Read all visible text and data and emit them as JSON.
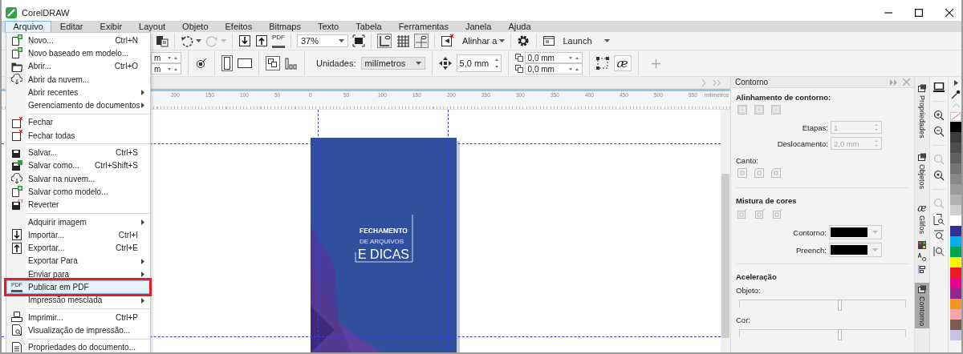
{
  "window": {
    "title": "CorelDRAW"
  },
  "menubar": [
    {
      "label": "Arquivo",
      "selected": true
    },
    {
      "label": "Editar",
      "selected": false
    },
    {
      "label": "Exibir",
      "selected": false
    },
    {
      "label": "Layout",
      "selected": false
    },
    {
      "label": "Objeto",
      "selected": false
    },
    {
      "label": "Efeitos",
      "selected": false
    },
    {
      "label": "Bitmaps",
      "selected": false
    },
    {
      "label": "Texto",
      "selected": false
    },
    {
      "label": "Tabela",
      "selected": false
    },
    {
      "label": "Ferramentas",
      "selected": false
    },
    {
      "label": "Janela",
      "selected": false
    },
    {
      "label": "Ajuda",
      "selected": false
    }
  ],
  "file_menu": {
    "items": [
      {
        "kind": "item",
        "label": "Novo...",
        "shortcut": "Ctrl+N",
        "submenu": false,
        "selected": false,
        "outlined": false
      },
      {
        "kind": "item",
        "label": "Novo baseado em modelo...",
        "submenu": false,
        "selected": false,
        "outlined": false
      },
      {
        "kind": "item",
        "label": "Abrir...",
        "shortcut": "Ctrl+O",
        "submenu": false,
        "selected": false,
        "outlined": false
      },
      {
        "kind": "item",
        "label": "Abrir da nuvem...",
        "submenu": false,
        "selected": false,
        "outlined": false
      },
      {
        "kind": "item",
        "label": "Abrir recentes",
        "submenu": true,
        "selected": false,
        "outlined": false
      },
      {
        "kind": "item",
        "label": "Gerenciamento de documentos",
        "submenu": true,
        "selected": false,
        "outlined": false
      },
      {
        "kind": "separator"
      },
      {
        "kind": "item",
        "label": "Fechar",
        "submenu": false,
        "selected": false,
        "outlined": false
      },
      {
        "kind": "item",
        "label": "Fechar todas",
        "submenu": false,
        "selected": false,
        "outlined": false
      },
      {
        "kind": "separator"
      },
      {
        "kind": "item",
        "label": "Salvar...",
        "shortcut": "Ctrl+S",
        "submenu": false,
        "selected": false,
        "outlined": false
      },
      {
        "kind": "item",
        "label": "Salvar como...",
        "shortcut": "Ctrl+Shift+S",
        "submenu": false,
        "selected": false,
        "outlined": false
      },
      {
        "kind": "item",
        "label": "Salvar na nuvem...",
        "submenu": false,
        "selected": false,
        "outlined": false
      },
      {
        "kind": "item",
        "label": "Salvar como modelo...",
        "submenu": false,
        "selected": false,
        "outlined": false
      },
      {
        "kind": "item",
        "label": "Reverter",
        "submenu": false,
        "selected": false,
        "outlined": false
      },
      {
        "kind": "separator"
      },
      {
        "kind": "item",
        "label": "Adquirir imagem",
        "submenu": true,
        "selected": false,
        "outlined": false
      },
      {
        "kind": "item",
        "label": "Importar...",
        "shortcut": "Ctrl+I",
        "submenu": false,
        "selected": false,
        "outlined": false
      },
      {
        "kind": "item",
        "label": "Exportar...",
        "shortcut": "Ctrl+E",
        "submenu": false,
        "selected": false,
        "outlined": false
      },
      {
        "kind": "item",
        "label": "Exportar Para",
        "submenu": true,
        "selected": false,
        "outlined": false
      },
      {
        "kind": "item",
        "label": "Enviar para",
        "submenu": true,
        "selected": false,
        "outlined": false
      },
      {
        "kind": "item",
        "label": "Publicar em PDF",
        "icon_text": "PDF",
        "submenu": false,
        "selected": true,
        "outlined": true
      },
      {
        "kind": "item",
        "label": "Impressão mesclada",
        "submenu": true,
        "selected": false,
        "outlined": false
      },
      {
        "kind": "separator"
      },
      {
        "kind": "item",
        "label": "Imprimir...",
        "shortcut": "Ctrl+P",
        "submenu": false,
        "selected": false,
        "outlined": false
      },
      {
        "kind": "item",
        "label": "Visualização de impressão...",
        "submenu": false,
        "selected": false,
        "outlined": false
      },
      {
        "kind": "separator"
      },
      {
        "kind": "item",
        "label": "Propriedades do documento...",
        "submenu": false,
        "selected": false,
        "outlined": false
      }
    ]
  },
  "toolbar": {
    "pdf_icon_text": "PDF",
    "zoom": "37%",
    "snap_label": "Alinhar a",
    "launch_label": "Launch"
  },
  "property_bar": {
    "size_fields": [
      "m",
      "m"
    ],
    "units_label": "Unidades:",
    "units": "milímetros",
    "nudge": "5,0 mm",
    "duplicate_fields": [
      "0,0 mm",
      "0,0 mm"
    ],
    "glyph_button": "æ"
  },
  "ruler": {
    "labels": [
      "200",
      "150",
      "100",
      "50",
      "0",
      "50",
      "100",
      "150",
      "200",
      "250",
      "300",
      "350",
      "400",
      "450",
      "500",
      "550"
    ],
    "unit": "milímetros"
  },
  "document_page": {
    "lines": [
      "FECHAMENTO",
      "DE ARQUIVOS",
      "E DICAS"
    ]
  },
  "docker": {
    "title": "Contorno",
    "alignment_heading": "Alinhamento de contorno:",
    "steps_label": "Etapas:",
    "steps_value": "1",
    "offset_label": "Deslocamento:",
    "offset_value": "2,0 mm",
    "fields_disabled": true,
    "corner_label": "Canto:",
    "blend_heading": "Mistura de cores",
    "color_pickers": [
      {
        "label": "Contorno:",
        "color": "#000000"
      },
      {
        "label": "Preench:",
        "color": "#000000"
      }
    ],
    "acceleration_heading": "Aceleração",
    "object_label": "Objeto:",
    "object_slider": {
      "level": 0.6
    },
    "color_label": "Cor:",
    "color_slider": {
      "level": 0.6
    }
  },
  "docker_tabs": [
    {
      "label": "Propriedades",
      "selected": false
    },
    {
      "label": "Objetos",
      "selected": false
    },
    {
      "label": "Glifos",
      "glyph": "æ",
      "selected": false
    },
    {
      "label": "Contorno",
      "selected": true
    }
  ],
  "palette": [
    {
      "kind": "none"
    },
    {
      "kind": "swatch",
      "color": "#000000"
    },
    {
      "kind": "swatch",
      "color": "#3c3c3c"
    },
    {
      "kind": "swatch",
      "color": "#4e4e4e"
    },
    {
      "kind": "swatch",
      "color": "#606060"
    },
    {
      "kind": "swatch",
      "color": "#747474"
    },
    {
      "kind": "swatch",
      "color": "#888888"
    },
    {
      "kind": "swatch",
      "color": "#9c9c9c"
    },
    {
      "kind": "swatch",
      "color": "#b2b2b2"
    },
    {
      "kind": "swatch",
      "color": "#d0d0d0"
    },
    {
      "kind": "swatch",
      "color": "#ffffff"
    },
    {
      "kind": "swatch",
      "color": "#2e3192"
    },
    {
      "kind": "swatch",
      "color": "#00aeef"
    },
    {
      "kind": "swatch",
      "color": "#00a651"
    },
    {
      "kind": "swatch",
      "color": "#fff200"
    },
    {
      "kind": "swatch",
      "color": "#ed1c24"
    },
    {
      "kind": "swatch",
      "color": "#ec008c"
    },
    {
      "kind": "swatch",
      "color": "#92278f"
    },
    {
      "kind": "swatch",
      "color": "#f7941d"
    },
    {
      "kind": "swatch",
      "color": "#f4a7a7"
    },
    {
      "kind": "swatch",
      "color": "#7b5d50"
    },
    {
      "kind": "swatch",
      "color": "#c8c2e2"
    }
  ]
}
